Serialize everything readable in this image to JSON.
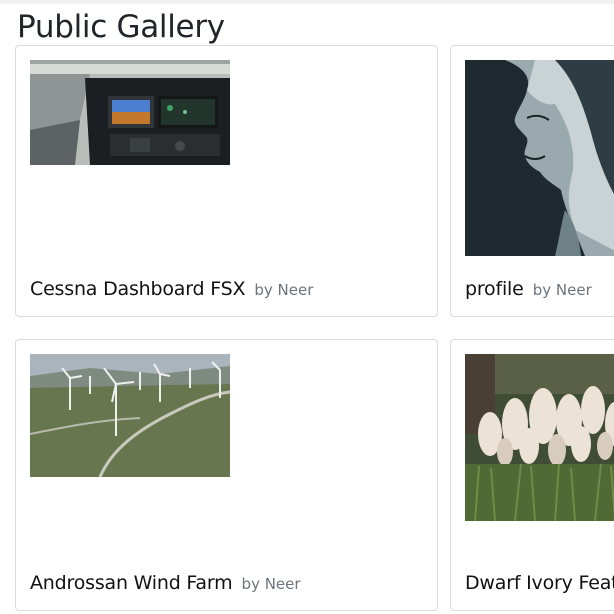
{
  "page": {
    "title": "Public Gallery"
  },
  "gallery": {
    "items": [
      {
        "title": "Cessna Dashboard FSX",
        "byline": "by Neer",
        "image": "cockpit-dashboard-photo"
      },
      {
        "title": "profile",
        "byline": "by Neer",
        "image": "woman-profile-illustration"
      },
      {
        "title": "Androssan Wind Farm",
        "byline": "by Neer",
        "image": "wind-farm-photo"
      },
      {
        "title": "Dwarf Ivory Feat",
        "byline": "",
        "image": "pampas-grass-photo"
      }
    ]
  }
}
